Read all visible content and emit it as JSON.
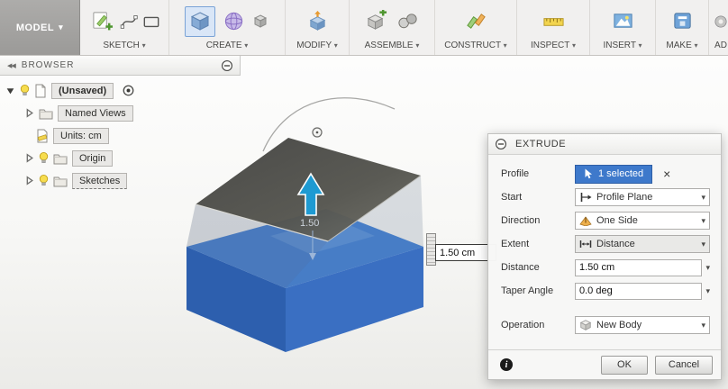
{
  "toolbar": {
    "model_label": "MODEL",
    "groups": [
      {
        "label": "SKETCH"
      },
      {
        "label": "CREATE"
      },
      {
        "label": "MODIFY"
      },
      {
        "label": "ASSEMBLE"
      },
      {
        "label": "CONSTRUCT"
      },
      {
        "label": "INSPECT"
      },
      {
        "label": "INSERT"
      },
      {
        "label": "MAKE"
      },
      {
        "label": "AD"
      }
    ]
  },
  "browser": {
    "title": "BROWSER",
    "root_label": "(Unsaved)",
    "items": [
      {
        "label": "Named Views"
      },
      {
        "label": "Units: cm"
      },
      {
        "label": "Origin"
      },
      {
        "label": "Sketches"
      }
    ]
  },
  "canvas": {
    "dimension_label": "1.50",
    "dimension_value": "1.50 cm"
  },
  "dialog": {
    "title": "EXTRUDE",
    "rows": {
      "profile": {
        "label": "Profile",
        "value": "1 selected"
      },
      "start": {
        "label": "Start",
        "value": "Profile Plane"
      },
      "direction": {
        "label": "Direction",
        "value": "One Side"
      },
      "extent": {
        "label": "Extent",
        "value": "Distance"
      },
      "distance": {
        "label": "Distance",
        "value": "1.50 cm"
      },
      "taper": {
        "label": "Taper Angle",
        "value": "0.0 deg"
      },
      "operation": {
        "label": "Operation",
        "value": "New Body"
      }
    },
    "ok_label": "OK",
    "cancel_label": "Cancel"
  },
  "icons": {
    "caret_down": "▾",
    "collapse_left": "◀◀",
    "close": "×",
    "info": "i"
  },
  "colors": {
    "accent_blue": "#3e79cb",
    "selection_blue": "#3f7fd6",
    "highlight_bg": "#d9e6f7"
  }
}
